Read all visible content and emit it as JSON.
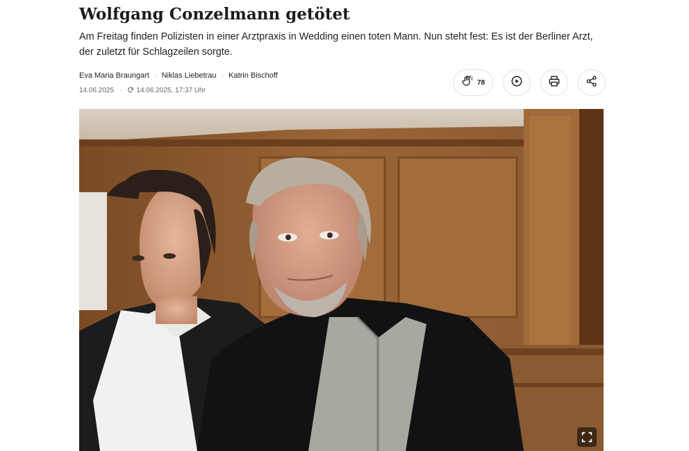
{
  "article": {
    "headline": "Wolfgang Conzelmann getötet",
    "lead": "Am Freitag finden Polizisten in einer Arztpraxis in Wedding einen toten Mann. Nun steht fest: Es ist der Berliner Arzt, der zuletzt für Schlagzeilen sorgte.",
    "authors": [
      "Eva Maria Braungart",
      "Niklas Liebetrau",
      "Katrin Bischoff"
    ],
    "published_date": "14.06.2025",
    "updated_date": "14.06.2025, 17:37 Uhr"
  },
  "actions": {
    "applause_count": "78",
    "applause_icon": "applause-hand-icon",
    "play_icon": "play-icon",
    "print_icon": "print-icon",
    "share_icon": "share-icon"
  },
  "photo": {
    "fullscreen_icon": "fullscreen-icon"
  }
}
